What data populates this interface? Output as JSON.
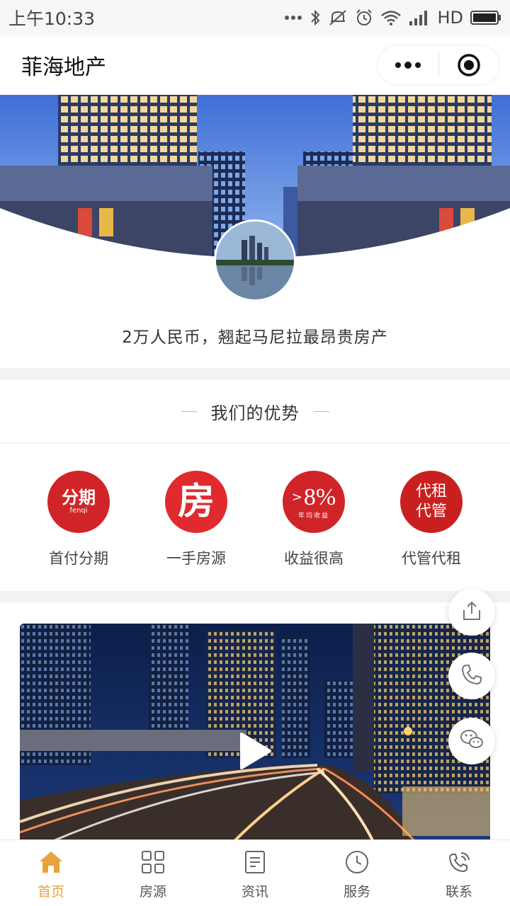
{
  "status_bar": {
    "time": "上午10:33",
    "network": "HD",
    "icons": [
      "dots-icon",
      "bluetooth-icon",
      "mute-icon",
      "alarm-icon",
      "wifi-icon",
      "signal-icon",
      "battery-icon"
    ]
  },
  "header": {
    "title": "菲海地产",
    "menu_icon": "more-dots-icon",
    "close_icon": "target-close-icon"
  },
  "hero": {
    "slogan": "2万人民币，翘起马尼拉最昂贵房产"
  },
  "advantages": {
    "title": "我们的优势",
    "items": [
      {
        "label": "首付分期",
        "icon_text": "分期",
        "icon_sub": "fenqi"
      },
      {
        "label": "一手房源",
        "icon_text": "房"
      },
      {
        "label": "收益很高",
        "icon_text": "8%",
        "icon_prefix": ">",
        "icon_sub": "年均收益"
      },
      {
        "label": "代管代租",
        "icon_text_line1": "代租",
        "icon_text_line2": "代管"
      }
    ]
  },
  "floating_actions": [
    "share-icon",
    "phone-icon",
    "wechat-icon"
  ],
  "tabbar": {
    "items": [
      {
        "label": "首页",
        "icon": "home-icon",
        "active": true
      },
      {
        "label": "房源",
        "icon": "grid-icon",
        "active": false
      },
      {
        "label": "资讯",
        "icon": "document-icon",
        "active": false
      },
      {
        "label": "服务",
        "icon": "clock-icon",
        "active": false
      },
      {
        "label": "联系",
        "icon": "phone-call-icon",
        "active": false
      }
    ]
  },
  "colors": {
    "accent": "#e8a33c",
    "brand_red": "#d12428",
    "background": "#f2f2f2"
  }
}
